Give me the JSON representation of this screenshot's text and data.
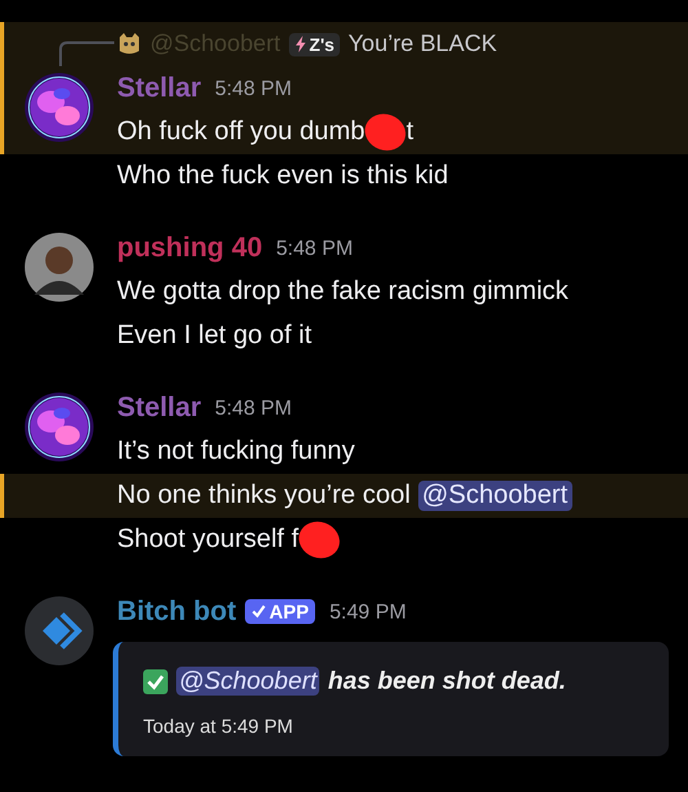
{
  "messages": [
    {
      "author": "Stellar",
      "color": "#8e5bb0",
      "time": "5:48 PM",
      "avatar": {
        "kind": "orb"
      },
      "highlighted": true,
      "reply": {
        "mention": "@Schoobert",
        "tag": "Z's",
        "text": "You’re BLACK"
      },
      "lines": [
        {
          "highlighted": true,
          "parts": [
            {
              "kind": "text",
              "text": "Oh fuck off you dumb"
            },
            {
              "kind": "redaction"
            },
            {
              "kind": "text",
              "text": "t"
            }
          ]
        },
        {
          "highlighted": false,
          "parts": [
            {
              "kind": "text",
              "text": "Who the fuck even is this kid"
            }
          ]
        }
      ]
    },
    {
      "author": "pushing 40",
      "color": "#c0305a",
      "time": "5:48 PM",
      "avatar": {
        "kind": "person"
      },
      "highlighted": false,
      "lines": [
        {
          "highlighted": false,
          "parts": [
            {
              "kind": "text",
              "text": "We gotta drop the fake racism gimmick"
            }
          ]
        },
        {
          "highlighted": false,
          "parts": [
            {
              "kind": "text",
              "text": "Even I let go of it"
            }
          ]
        }
      ]
    },
    {
      "author": "Stellar",
      "color": "#8e5bb0",
      "time": "5:48 PM",
      "avatar": {
        "kind": "orb"
      },
      "highlighted": false,
      "lines": [
        {
          "highlighted": false,
          "parts": [
            {
              "kind": "text",
              "text": "It’s not fucking funny"
            }
          ]
        },
        {
          "highlighted": true,
          "parts": [
            {
              "kind": "text",
              "text": "No one thinks you’re cool "
            },
            {
              "kind": "mention",
              "text": "@Schoobert"
            }
          ]
        },
        {
          "highlighted": false,
          "parts": [
            {
              "kind": "text",
              "text": "Shoot yourself f"
            },
            {
              "kind": "redaction"
            }
          ]
        }
      ]
    },
    {
      "author": "Bitch bot",
      "color": "#3d88b8",
      "time": "5:49 PM",
      "avatar": {
        "kind": "bot"
      },
      "badge": "APP",
      "highlighted": false,
      "embed": {
        "mention": "@Schoobert",
        "text": "has been shot dead.",
        "footer": "Today at 5:49 PM"
      }
    }
  ]
}
